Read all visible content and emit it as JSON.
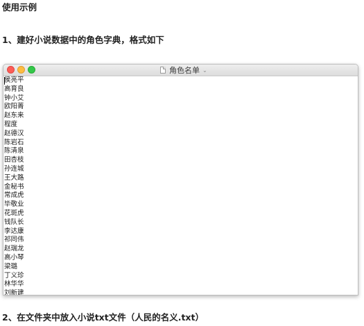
{
  "headings": {
    "usage": "使用示例",
    "step1": "1、建好小说数据中的角色字典，格式如下",
    "step2": "2、在文件夹中放入小说txt文件（人民的名义.txt）"
  },
  "window": {
    "title": "角色名单",
    "title_chevron": "⌄",
    "traffic_light_colors": {
      "close": "#fc5d56",
      "minimize": "#fdbc40",
      "maximize": "#34c84a"
    }
  },
  "names": [
    "侯亮平",
    "高育良",
    "钟小艾",
    "欧阳菁",
    "赵东来",
    "程度",
    "赵德汉",
    "陈岩石",
    "陈清泉",
    "田杏枝",
    "孙连城",
    "王大路",
    "金秘书",
    "常成虎",
    "毕敬业",
    "花斑虎",
    "钱队长",
    "李达康",
    "祁同伟",
    "赵瑞龙",
    "高小琴",
    "梁璐",
    "丁义珍",
    "林华华",
    "刘新建"
  ]
}
